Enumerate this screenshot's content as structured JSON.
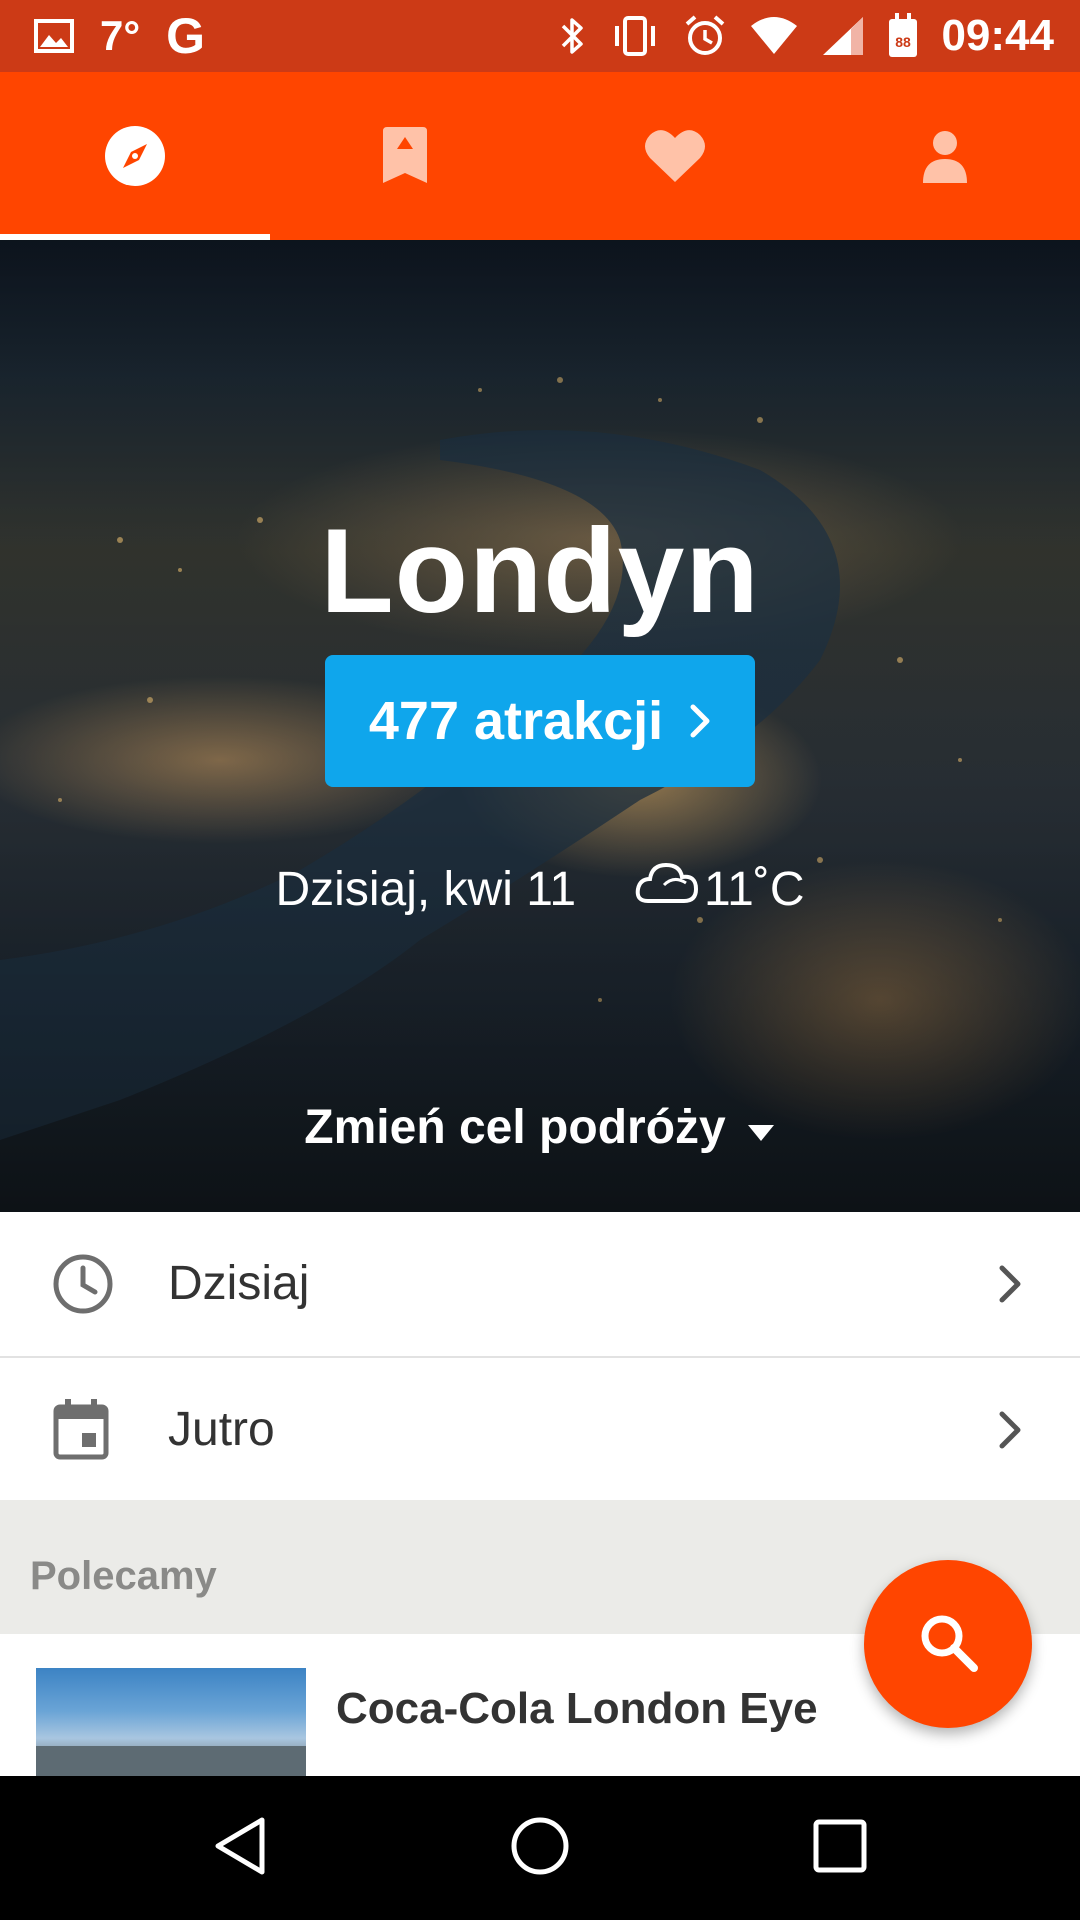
{
  "status_bar": {
    "temperature": "7°",
    "g_label": "G",
    "time": "09:44",
    "calendar_day": "88",
    "icons": [
      "image-icon",
      "google-icon",
      "bluetooth-icon",
      "vibrate-icon",
      "alarm-icon",
      "wifi-icon",
      "signal-icon",
      "calendar-icon"
    ]
  },
  "tabs": [
    {
      "icon": "compass-icon",
      "active": true
    },
    {
      "icon": "bookmark-icon",
      "active": false
    },
    {
      "icon": "heart-icon",
      "active": false
    },
    {
      "icon": "profile-icon",
      "active": false
    }
  ],
  "hero": {
    "city": "Londyn",
    "attractions_label": "477 atrakcji",
    "date": "Dzisiaj, kwi 11",
    "temperature": "11˚C",
    "change_destination": "Zmień cel podróży"
  },
  "list": [
    {
      "label": "Dzisiaj",
      "icon": "clock-icon"
    },
    {
      "label": "Jutro",
      "icon": "calendar-icon"
    }
  ],
  "recommended": {
    "title": "Polecamy",
    "items": [
      {
        "title": "Coca-Cola London Eye"
      }
    ]
  },
  "colors": {
    "accent": "#ff4500",
    "status_bar": "#cc3a16",
    "button_blue": "#0fa6ec"
  }
}
